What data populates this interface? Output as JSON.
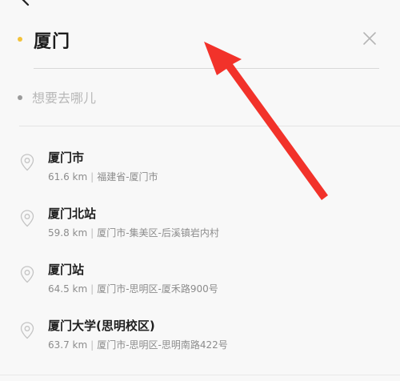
{
  "search": {
    "from_value": "厦门",
    "to_placeholder": "想要去哪儿"
  },
  "results": [
    {
      "name": "厦门市",
      "distance": "61.6 km",
      "address": "福建省-厦门市"
    },
    {
      "name": "厦门北站",
      "distance": "59.8 km",
      "address": "厦门市-集美区-后溪镇岩内村"
    },
    {
      "name": "厦门站",
      "distance": "64.5 km",
      "address": "厦门市-思明区-厦禾路900号"
    },
    {
      "name": "厦门大学(思明校区)",
      "distance": "63.7 km",
      "address": "厦门市-思明区-思明南路422号"
    }
  ],
  "colors": {
    "from_dot": "#f3c23a",
    "to_dot": "#9b9b9b",
    "annotation_arrow": "#f2322a"
  },
  "icons": {
    "back": "chevron-left-icon",
    "clear": "close-icon",
    "pin": "location-pin-icon"
  }
}
